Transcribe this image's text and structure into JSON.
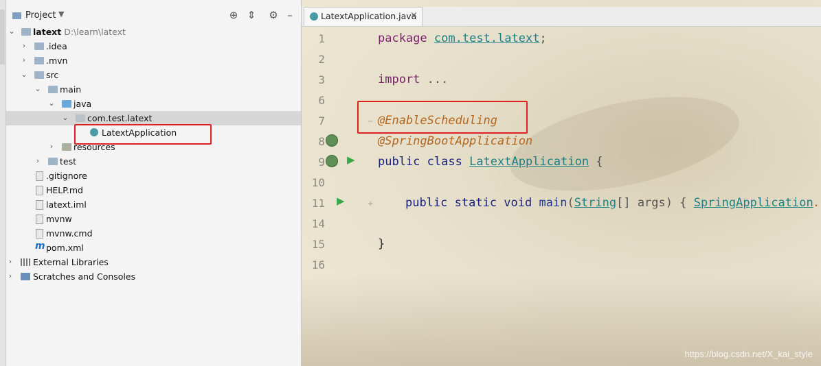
{
  "project_panel": {
    "title": "Project",
    "tree": [
      {
        "label": "latext",
        "path": "D:\\learn\\latext"
      },
      {
        "label": ".idea"
      },
      {
        "label": ".mvn"
      },
      {
        "label": "src"
      },
      {
        "label": "main"
      },
      {
        "label": "java"
      },
      {
        "label": "com.test.latext"
      },
      {
        "label": "LatextApplication"
      },
      {
        "label": "resources"
      },
      {
        "label": "test"
      },
      {
        "label": ".gitignore"
      },
      {
        "label": "HELP.md"
      },
      {
        "label": "latext.iml"
      },
      {
        "label": "mvnw"
      },
      {
        "label": "mvnw.cmd"
      },
      {
        "label": "pom.xml"
      },
      {
        "label": "External Libraries"
      },
      {
        "label": "Scratches and Consoles"
      }
    ]
  },
  "editor": {
    "tab_label": "LatextApplication.java",
    "line_numbers": [
      "1",
      "2",
      "3",
      "6",
      "7",
      "8",
      "9",
      "10",
      "11",
      "14",
      "15",
      "16"
    ],
    "code": {
      "l1_kw": "package",
      "l1_pkg": "com.test.latext",
      "l1_end": ";",
      "l3_kw": "import",
      "l3_rest": " ...",
      "l7": "@EnableScheduling",
      "l8": "@SpringBootApplication",
      "l9_kw": "public class",
      "l9_cls": "LatextApplication",
      "l9_end": " {",
      "l11_kw": "public static void",
      "l11_fn": "main",
      "l11_p1": "(",
      "l11_type": "String",
      "l11_p2": "[] args) { ",
      "l11_cls": "SpringApplication",
      "l11_tail": ".ru",
      "l15": "}"
    }
  },
  "watermark": "https://blog.csdn.net/X_kai_style",
  "colors": {
    "highlight_box": "#e02020",
    "keyword": "#1a237e",
    "annotation": "#b5651d"
  }
}
